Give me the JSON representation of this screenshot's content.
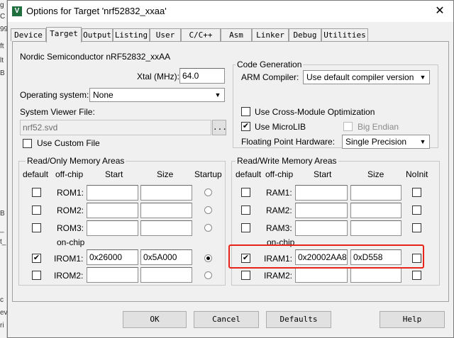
{
  "left_strip": [
    "g",
    "C",
    "99",
    "ft",
    "lt",
    "B",
    "B",
    "_",
    "t_",
    "c",
    "ev",
    "ri"
  ],
  "window": {
    "title": "Options for Target 'nrf52832_xxaa'",
    "app_icon_label": "V",
    "close_glyph": "✕"
  },
  "tabs": [
    "Device",
    "Target",
    "Output",
    "Listing",
    "User",
    "C/C++",
    "Asm",
    "Linker",
    "Debug",
    "Utilities"
  ],
  "active_tab": "Target",
  "device": {
    "name": "Nordic Semiconductor nRF52832_xxAA",
    "xtal_label": "Xtal (MHz):",
    "xtal_value": "64.0"
  },
  "os": {
    "label": "Operating system:",
    "value": "None"
  },
  "svd": {
    "label": "System Viewer File:",
    "value": "nrf52.svd",
    "browse": "...",
    "custom_label": "Use Custom File"
  },
  "codegen": {
    "title": "Code Generation",
    "compiler_label": "ARM Compiler:",
    "compiler_value": "Use default compiler version",
    "cross_module_label": "Use Cross-Module Optimization",
    "microlib_label": "Use MicroLIB",
    "big_endian_label": "Big Endian",
    "fp_label": "Floating Point Hardware:",
    "fp_value": "Single Precision"
  },
  "rom": {
    "title": "Read/Only Memory Areas",
    "headers": {
      "default": "default",
      "offchip": "off-chip",
      "start": "Start",
      "size": "Size",
      "startup": "Startup"
    },
    "onchip_label": "on-chip",
    "rows": [
      {
        "name": "ROM1:",
        "start": "",
        "size": "",
        "checked": false,
        "startup": false
      },
      {
        "name": "ROM2:",
        "start": "",
        "size": "",
        "checked": false,
        "startup": false
      },
      {
        "name": "ROM3:",
        "start": "",
        "size": "",
        "checked": false,
        "startup": false
      },
      {
        "name": "IROM1:",
        "start": "0x26000",
        "size": "0x5A000",
        "checked": true,
        "startup": true
      },
      {
        "name": "IROM2:",
        "start": "",
        "size": "",
        "checked": false,
        "startup": false
      }
    ]
  },
  "ram": {
    "title": "Read/Write Memory Areas",
    "headers": {
      "default": "default",
      "offchip": "off-chip",
      "start": "Start",
      "size": "Size",
      "noinit": "NoInit"
    },
    "onchip_label": "on-chip",
    "rows": [
      {
        "name": "RAM1:",
        "start": "",
        "size": "",
        "checked": false,
        "noinit": false
      },
      {
        "name": "RAM2:",
        "start": "",
        "size": "",
        "checked": false,
        "noinit": false
      },
      {
        "name": "RAM3:",
        "start": "",
        "size": "",
        "checked": false,
        "noinit": false
      },
      {
        "name": "IRAM1:",
        "start": "0x20002AA8",
        "size": "0xD558",
        "checked": true,
        "noinit": false
      },
      {
        "name": "IRAM2:",
        "start": "",
        "size": "",
        "checked": false,
        "noinit": false
      }
    ]
  },
  "buttons": {
    "ok": "OK",
    "cancel": "Cancel",
    "defaults": "Defaults",
    "help": "Help"
  },
  "check_glyph": "✔",
  "dropdown_glyph": "▼",
  "colors": {
    "highlight": "#e8241a",
    "app_icon": "#1f6f3f"
  }
}
